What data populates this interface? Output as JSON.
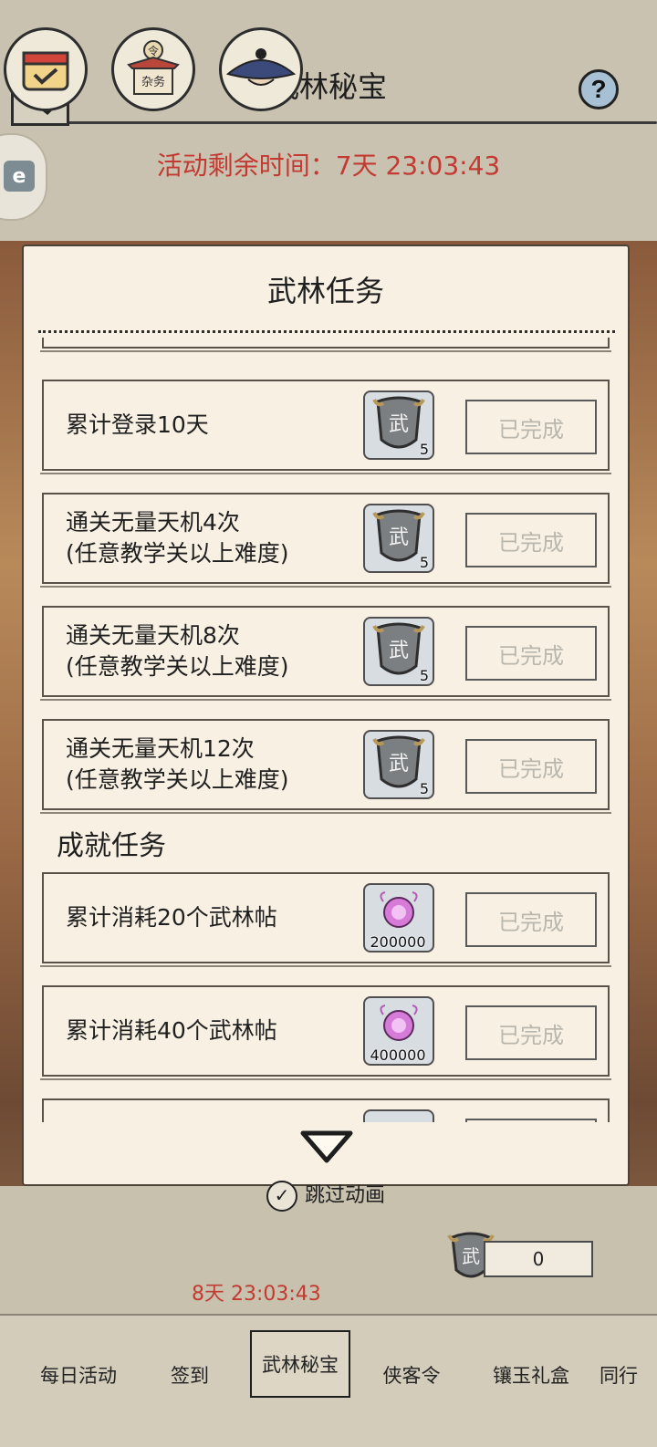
{
  "header": {
    "title": "武林秘宝",
    "help_label": "?",
    "countdown": "活动剩余时间：7天 23:03:43"
  },
  "modal": {
    "title": "武林任务",
    "section_achievements": "成就任务",
    "tasks": [
      {
        "line1": "累计登录10天",
        "line2": "",
        "reward_icon": "wu-shield-token",
        "reward_qty": "5",
        "status": "已完成"
      },
      {
        "line1": "通关无量天机4次",
        "line2": "(任意教学关以上难度)",
        "reward_icon": "wu-shield-token",
        "reward_qty": "5",
        "status": "已完成"
      },
      {
        "line1": "通关无量天机8次",
        "line2": "(任意教学关以上难度)",
        "reward_icon": "wu-shield-token",
        "reward_qty": "5",
        "status": "已完成"
      },
      {
        "line1": "通关无量天机12次",
        "line2": "(任意教学关以上难度)",
        "reward_icon": "wu-shield-token",
        "reward_qty": "5",
        "status": "已完成"
      }
    ],
    "achievements": [
      {
        "line1": "累计消耗20个武林帖",
        "reward_icon": "purple-orb",
        "reward_qty": "200000",
        "status": "已完成"
      },
      {
        "line1": "累计消耗40个武林帖",
        "reward_icon": "purple-orb",
        "reward_qty": "400000",
        "status": "已完成"
      }
    ]
  },
  "bottom": {
    "skip_label": "跳过动画",
    "feature_timer": "8天 23:03:43",
    "token_count": "0",
    "misc_label": "杂务",
    "ling_label": "令"
  },
  "tabs": [
    "每日活动",
    "签到",
    "武林秘宝",
    "侠客令",
    "镶玉礼盒",
    "同行"
  ],
  "colors": {
    "accent_red": "#c23a32",
    "paper": "#f8f1e3"
  }
}
